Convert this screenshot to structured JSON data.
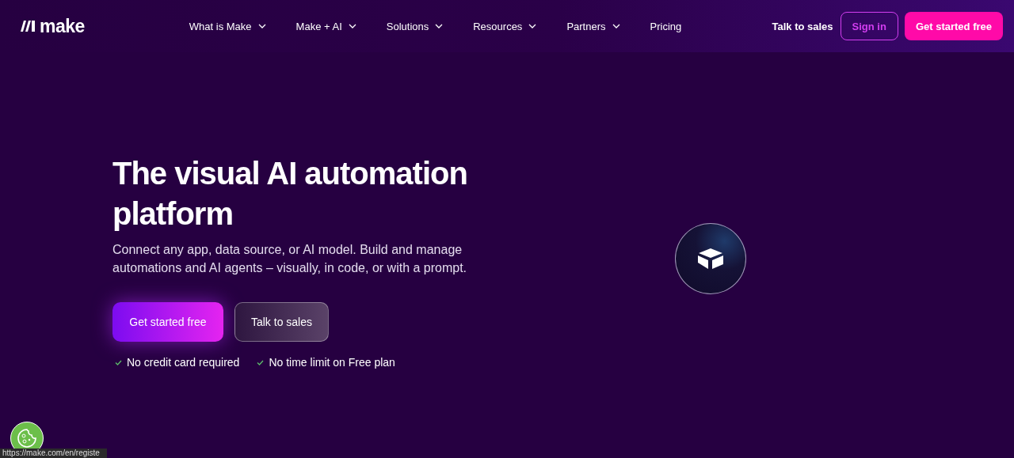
{
  "header": {
    "logo": "make",
    "nav": [
      {
        "label": "What is Make",
        "dropdown": true
      },
      {
        "label": "Make + AI",
        "dropdown": true
      },
      {
        "label": "Solutions",
        "dropdown": true
      },
      {
        "label": "Resources",
        "dropdown": true
      },
      {
        "label": "Partners",
        "dropdown": true
      },
      {
        "label": "Pricing",
        "dropdown": false
      }
    ],
    "talk_to_sales": "Talk to sales",
    "sign_in": "Sign in",
    "get_started": "Get started free"
  },
  "hero": {
    "title": "The visual AI automation platform",
    "subtitle": "Connect any app, data source, or AI model. Build and manage automations and AI agents – visually, in code, or with a prompt.",
    "primary_button": "Get started free",
    "secondary_button": "Talk to sales",
    "features": [
      "No credit card required",
      "No time limit on Free plan"
    ]
  },
  "status_bar": {
    "url": "https://make.com/en/registe"
  }
}
